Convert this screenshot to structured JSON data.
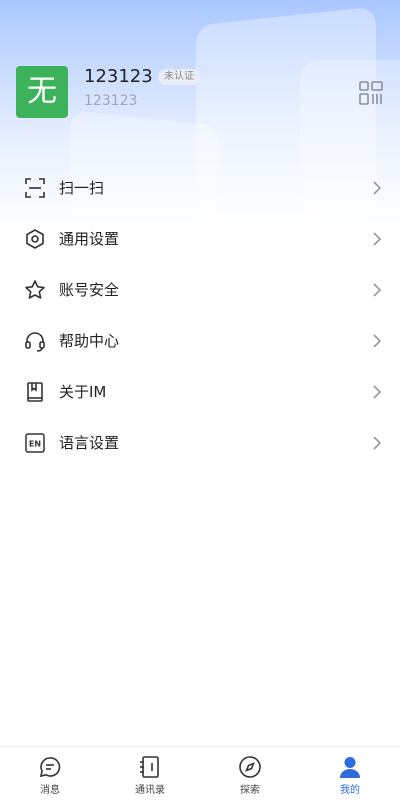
{
  "profile": {
    "avatar_char": "无",
    "name": "123123",
    "badge": "未认证",
    "id": "123123"
  },
  "menu": {
    "items": [
      {
        "label": "扫一扫",
        "icon": "scan-icon"
      },
      {
        "label": "通用设置",
        "icon": "hexagon-settings-icon"
      },
      {
        "label": "账号安全",
        "icon": "star-icon"
      },
      {
        "label": "帮助中心",
        "icon": "headset-icon"
      },
      {
        "label": "关于IM",
        "icon": "book-icon"
      },
      {
        "label": "语言设置",
        "icon": "language-en-icon"
      }
    ]
  },
  "tabs": [
    {
      "label": "消息",
      "icon": "chat-icon",
      "active": false
    },
    {
      "label": "通讯录",
      "icon": "contacts-icon",
      "active": false
    },
    {
      "label": "探索",
      "icon": "compass-icon",
      "active": false
    },
    {
      "label": "我的",
      "icon": "person-icon",
      "active": true
    }
  ],
  "colors": {
    "accent": "#2f6bdd",
    "avatar_bg": "#3cb35a"
  }
}
